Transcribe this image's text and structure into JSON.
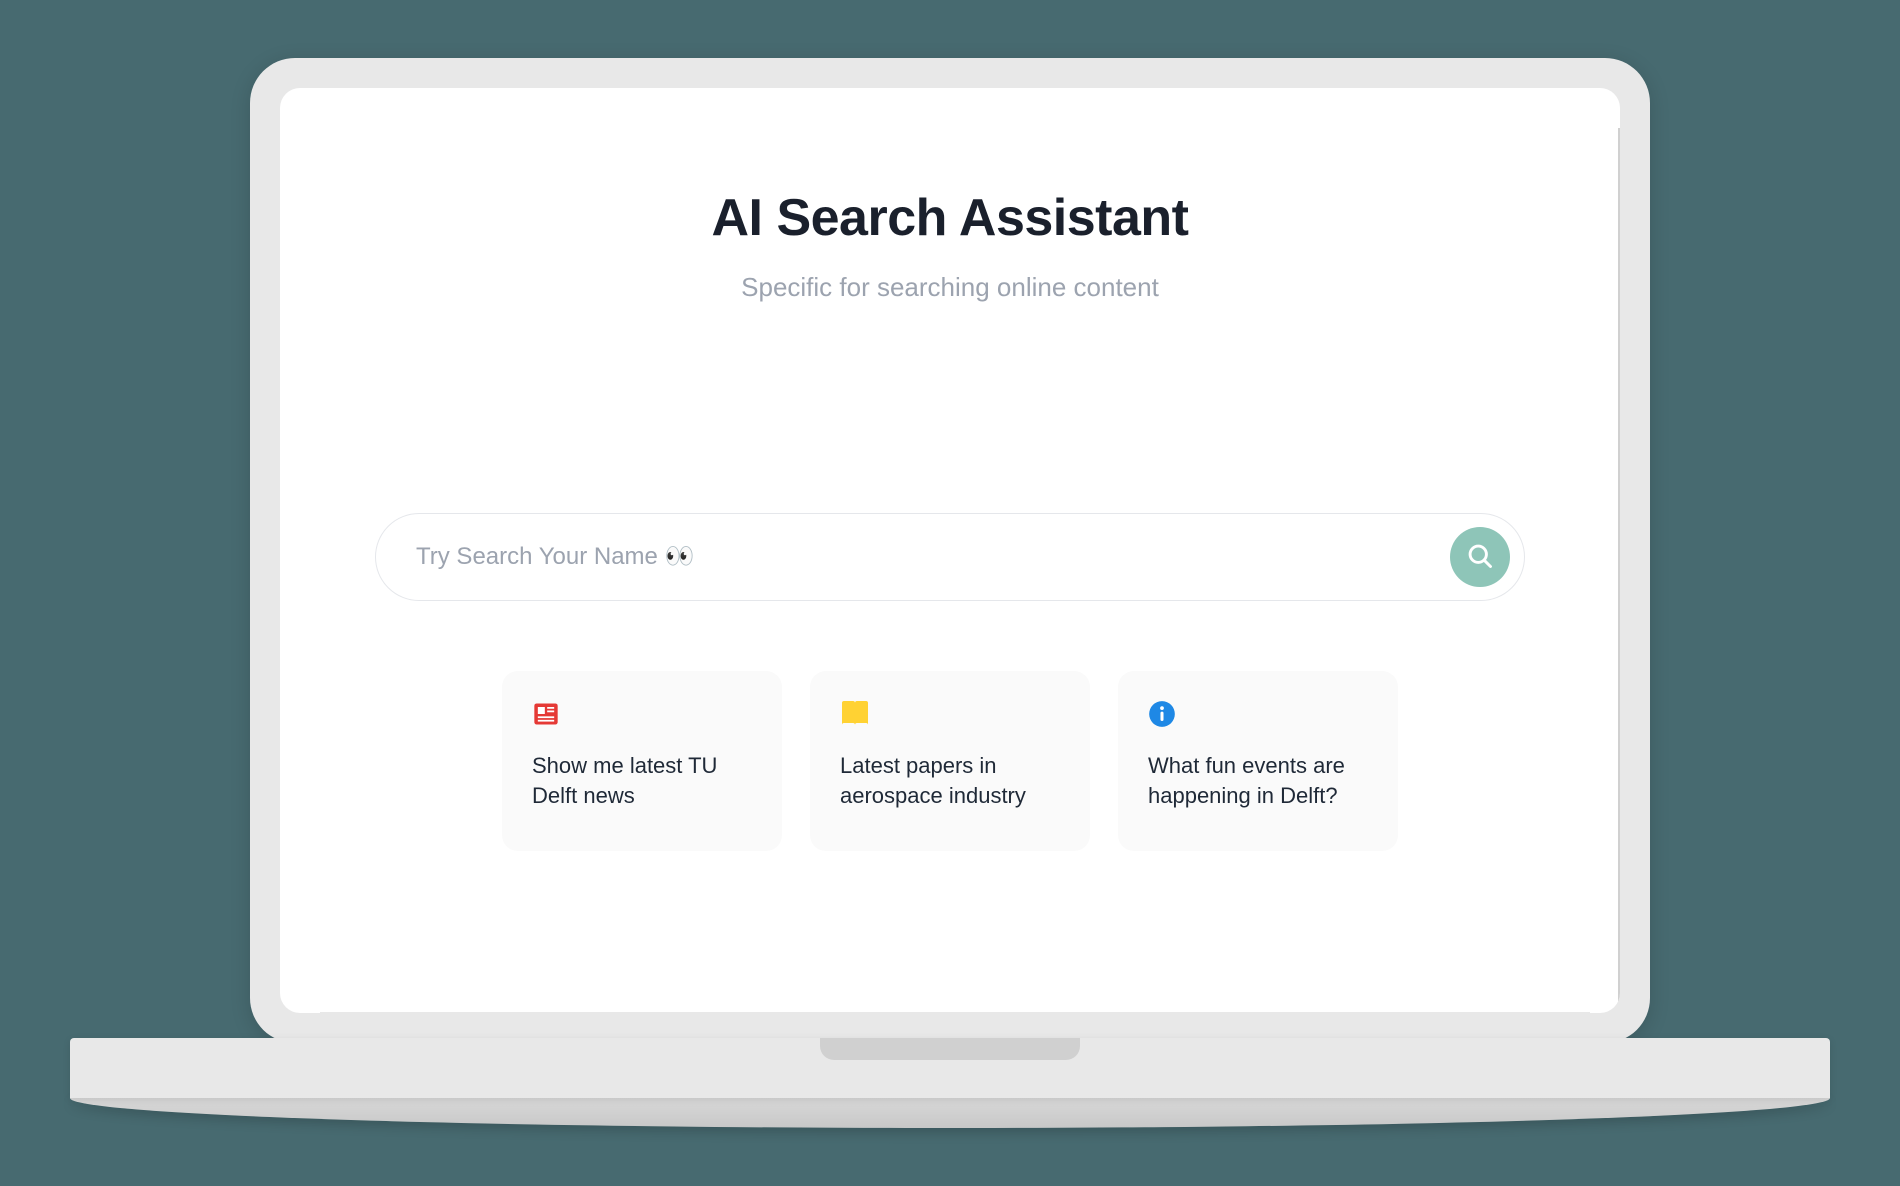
{
  "header": {
    "title": "AI Search Assistant",
    "subtitle": "Specific for searching online content"
  },
  "search": {
    "placeholder": "Try Search Your Name 👀",
    "value": ""
  },
  "suggestions": [
    {
      "icon": "newspaper-icon",
      "icon_color": "#e53935",
      "text": "Show me latest TU Delft news"
    },
    {
      "icon": "book-icon",
      "icon_color": "#ffd233",
      "text": "Latest papers in aerospace industry"
    },
    {
      "icon": "info-icon",
      "icon_color": "#1e88e5",
      "text": "What fun events are happening in Delft?"
    }
  ],
  "colors": {
    "background": "#476a70",
    "accent": "#8ec5b8",
    "text_primary": "#1a202c",
    "text_muted": "#9ca3af"
  }
}
